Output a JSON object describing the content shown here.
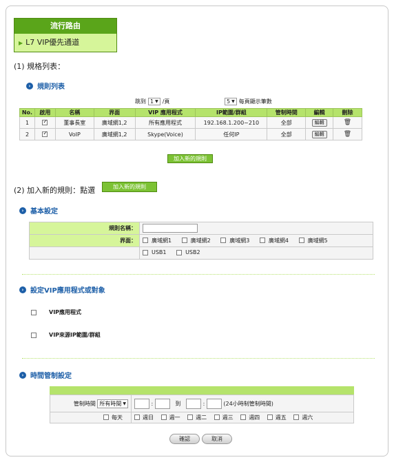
{
  "header": {
    "title": "流行路由",
    "subtitle": "L7 VIP優先通道"
  },
  "section1": {
    "label": "(1)  規格列表：",
    "heading": "規則列表",
    "pager": {
      "jump_label": "跳到",
      "page_value": "1",
      "page_suffix": "/頁",
      "per_page_value": "5",
      "per_page_suffix": "每頁顯示筆數"
    },
    "table": {
      "headers": [
        "No.",
        "啟用",
        "名稱",
        "界面",
        "VIP 應用程式",
        "IP範圍/群組",
        "管制時間",
        "編輯",
        "刪除"
      ],
      "rows": [
        {
          "no": "1",
          "enabled": true,
          "name": "董事長室",
          "iface": "廣域網1,2",
          "app": "所有應用程式",
          "ip": "192.168.1.200~210",
          "time": "全部",
          "edit": "編輯"
        },
        {
          "no": "2",
          "enabled": true,
          "name": "VoIP",
          "iface": "廣域網1,2",
          "app": "Skype(Voice)",
          "ip": "任何IP",
          "time": "全部",
          "edit": "編輯"
        }
      ]
    },
    "add_button": "加入新的規則"
  },
  "section2": {
    "label": "(2)  加入新的規則：點選",
    "add_button": "加入新的規則",
    "basic": {
      "heading": "基本設定",
      "rule_name_label": "規則名稱：",
      "rule_name_value": "",
      "iface_label": "界面：",
      "ifaces": [
        "廣域網1",
        "廣域網2",
        "廣域網3",
        "廣域網4",
        "廣域網5"
      ],
      "usbs": [
        "USB1",
        "USB2"
      ]
    },
    "vip": {
      "heading": "設定VIP應用程式或對象",
      "app_label": "VIP應用程式",
      "ip_label": "VIP來源IP範圍/群組"
    },
    "time": {
      "heading": "時間管制設定",
      "control_label": "管制時間",
      "control_value": "所有時間",
      "to_label": "到",
      "note": "(24小時制管制時間)",
      "days": [
        "每天",
        "週日",
        "週一",
        "週二",
        "週三",
        "週四",
        "週五",
        "週六"
      ]
    },
    "ok_button": "確認",
    "cancel_button": "取消"
  }
}
